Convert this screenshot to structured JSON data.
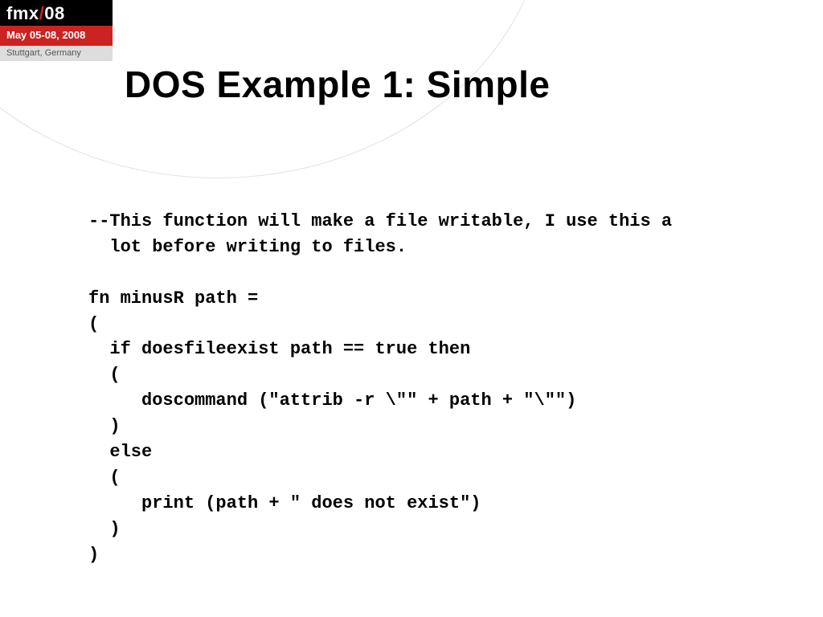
{
  "badge": {
    "name_prefix": "fmx",
    "slash": "/",
    "year": "08",
    "dates": "May 05-08, 2008",
    "location": "Stuttgart, Germany"
  },
  "slide": {
    "title": "DOS Example 1: Simple",
    "code": "--This function will make a file writable, I use this a\n  lot before writing to files.\n\nfn minusR path =\n(\n  if doesfileexist path == true then\n  (\n     doscommand (\"attrib -r \\\"\" + path + \"\\\"\")\n  )\n  else\n  (\n     print (path + \" does not exist\")\n  )\n)"
  }
}
